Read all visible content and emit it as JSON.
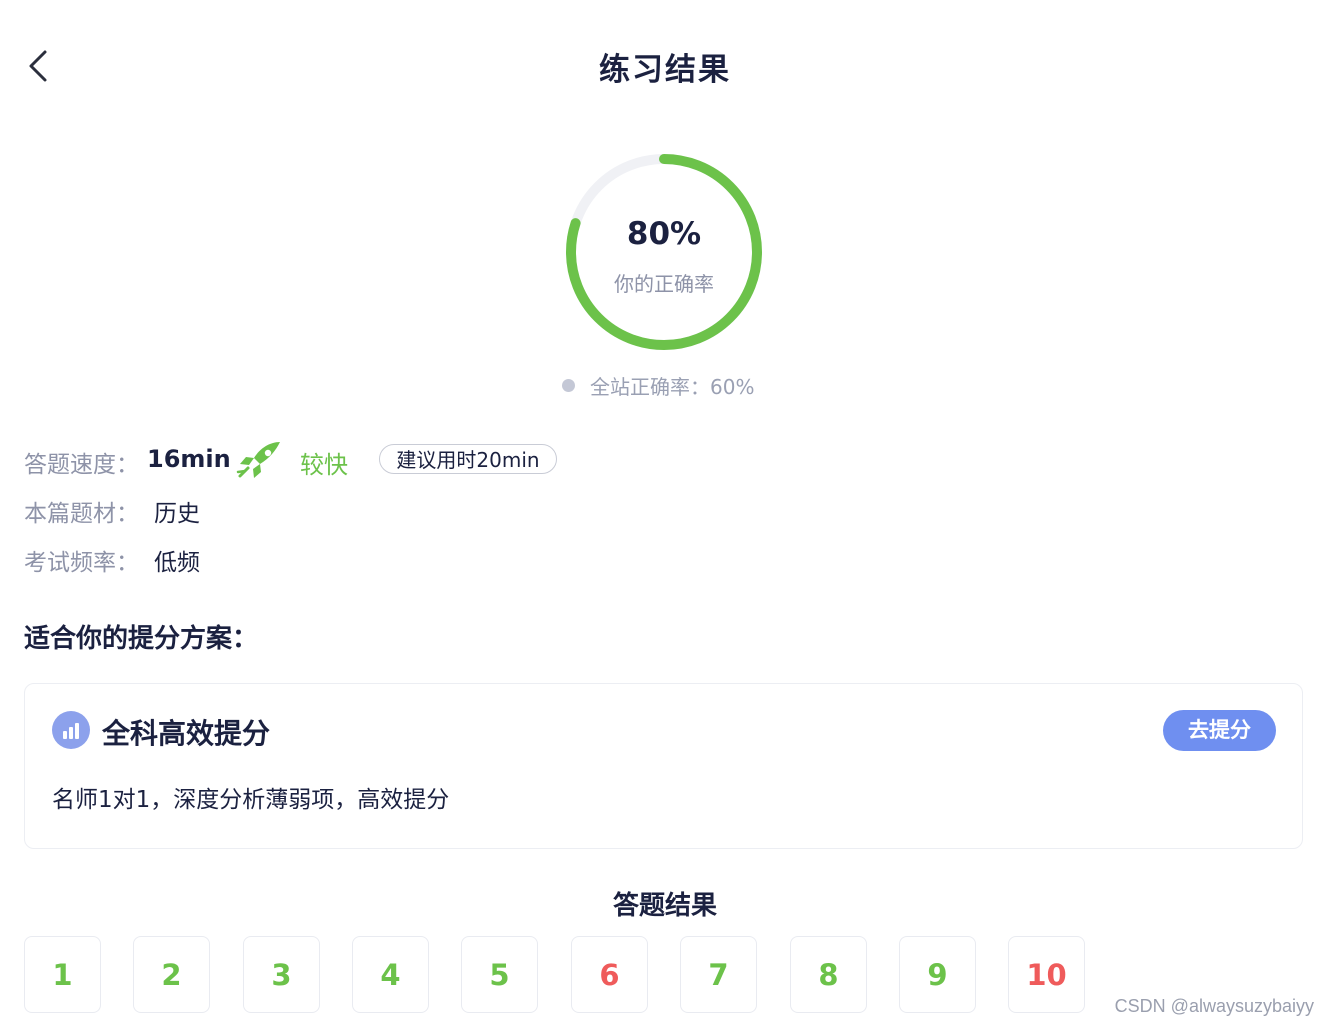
{
  "header": {
    "title": "练习结果"
  },
  "result": {
    "accuracy_text": "80%",
    "accuracy_fraction": 0.8,
    "accuracy_label": "你的正确率",
    "site_accuracy_text": "全站正确率：60%"
  },
  "info": {
    "speed_label": "答题速度：",
    "speed_value": "16min",
    "speed_rating": "较快",
    "suggested_time": "建议用时20min",
    "topic_label": "本篇题材：",
    "topic_value": "历史",
    "frequency_label": "考试频率：",
    "frequency_value": "低频"
  },
  "plan": {
    "section_title": "适合你的提分方案：",
    "card_title": "全科高效提分",
    "card_button": "去提分",
    "card_desc": "名师1对1，深度分析薄弱项，高效提分"
  },
  "answers": {
    "title": "答题结果",
    "items": [
      {
        "label": "1",
        "status": "correct"
      },
      {
        "label": "2",
        "status": "correct"
      },
      {
        "label": "3",
        "status": "correct"
      },
      {
        "label": "4",
        "status": "correct"
      },
      {
        "label": "5",
        "status": "correct"
      },
      {
        "label": "6",
        "status": "wrong"
      },
      {
        "label": "7",
        "status": "correct"
      },
      {
        "label": "8",
        "status": "correct"
      },
      {
        "label": "9",
        "status": "correct"
      },
      {
        "label": "10",
        "status": "wrong"
      }
    ]
  },
  "colors": {
    "correct": "#6cc24a",
    "wrong": "#ef5b5b",
    "ring_track": "#f0f1f5",
    "accent_button": "#6f8ff0"
  },
  "icons": {
    "back": "chevron-left-icon",
    "speed": "rocket-icon",
    "plan": "bar-chart-icon"
  },
  "watermark": "CSDN @alwaysuzybaiyy"
}
